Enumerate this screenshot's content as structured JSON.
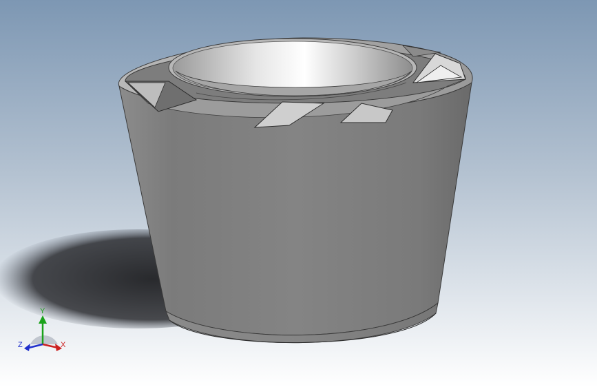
{
  "viewport": {
    "background_top": "#7f98b3",
    "background_bottom": "#ffffff",
    "part_color": "#8a8a8a",
    "shadow_color": "#2a2b2e"
  },
  "triad": {
    "y_label": "Y",
    "x_label": "X",
    "z_label": "Z",
    "y_color": "#1aa21a",
    "x_color": "#cc1f1f",
    "z_color": "#1f2fcc"
  }
}
